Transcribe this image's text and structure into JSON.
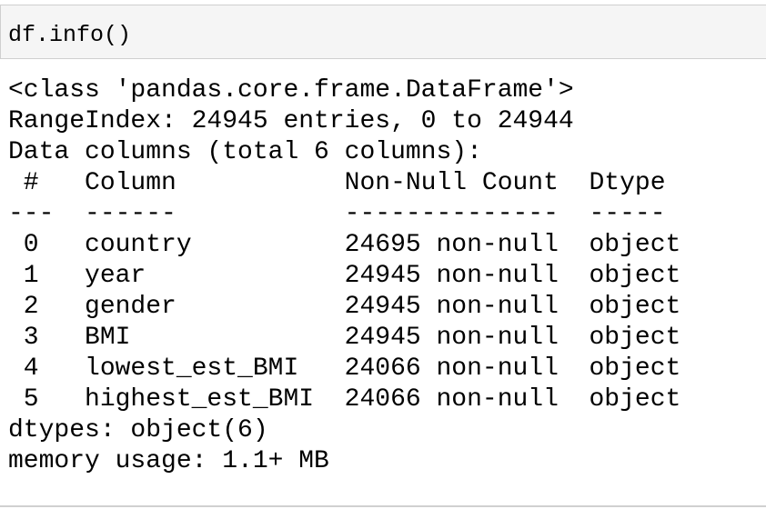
{
  "input": {
    "code": "df.info()"
  },
  "output": {
    "lines": [
      "<class 'pandas.core.frame.DataFrame'>",
      "RangeIndex: 24945 entries, 0 to 24944",
      "Data columns (total 6 columns):",
      " #   Column           Non-Null Count  Dtype ",
      "---  ------           --------------  ----- ",
      " 0   country          24695 non-null  object",
      " 1   year             24945 non-null  object",
      " 2   gender           24945 non-null  object",
      " 3   BMI              24945 non-null  object",
      " 4   lowest_est_BMI   24066 non-null  object",
      " 5   highest_est_BMI  24066 non-null  object",
      "dtypes: object(6)",
      "memory usage: 1.1+ MB"
    ]
  }
}
